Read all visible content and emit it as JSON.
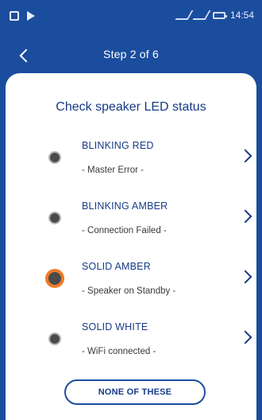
{
  "status_bar": {
    "time": "14:54"
  },
  "header": {
    "title": "Step 2 of 6"
  },
  "main": {
    "heading": "Check speaker LED status",
    "items": [
      {
        "title": "BLINKING RED",
        "description": "- Master Error -"
      },
      {
        "title": "BLINKING AMBER",
        "description": "- Connection Failed -"
      },
      {
        "title": "SOLID AMBER",
        "description": "- Speaker on Standby -"
      },
      {
        "title": "SOLID WHITE",
        "description": "- WiFi connected -"
      }
    ],
    "none_button": {
      "label": "NONE OF THESE"
    }
  },
  "colors": {
    "primary_blue": "#1b4d9e",
    "text_blue": "#173a86",
    "amber_accent": "#f07b2a"
  }
}
